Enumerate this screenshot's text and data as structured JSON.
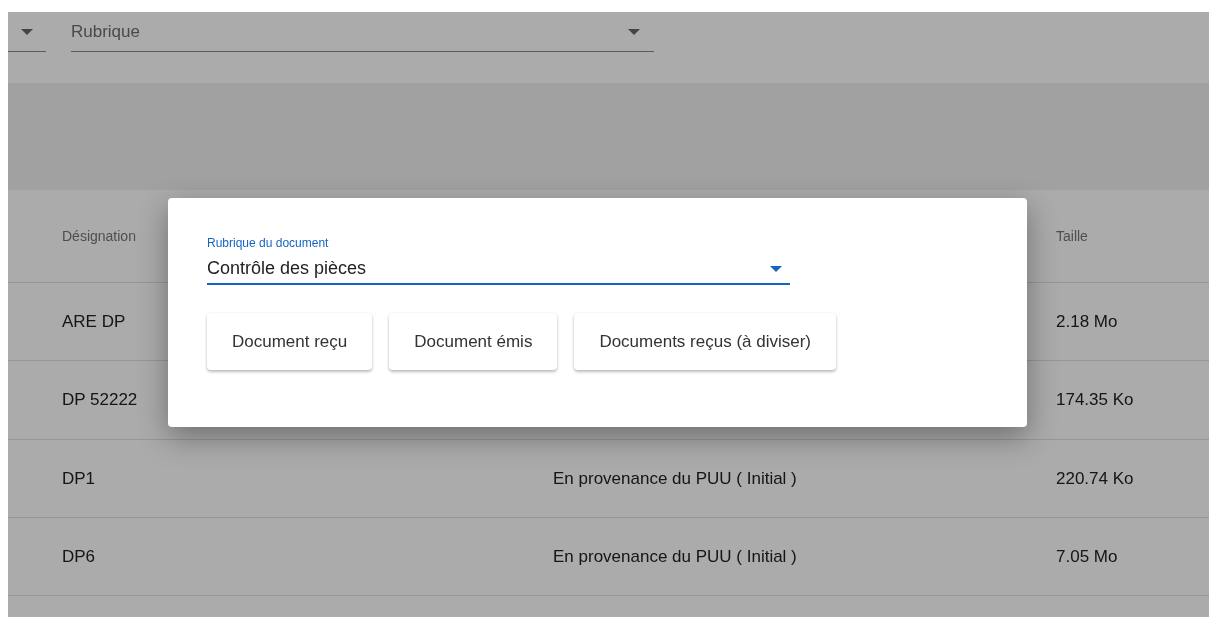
{
  "filters": [
    {
      "kind": "select"
    },
    {
      "kind": "select",
      "placeholder": "Rubrique"
    }
  ],
  "table": {
    "columns": {
      "designation": "Désignation",
      "size": "Taille"
    },
    "rows": [
      {
        "designation": "ARE DP",
        "size": "2.18 Mo"
      },
      {
        "designation": "DP 52222",
        "size": "174.35 Ko"
      },
      {
        "designation": "DP1",
        "origin": "En provenance du PUU ( Initial )",
        "size": "220.74 Ko"
      },
      {
        "designation": "DP6",
        "origin": "En provenance du PUU ( Initial )",
        "size": "7.05 Mo"
      }
    ]
  },
  "dialog": {
    "field": {
      "label": "Rubrique du document",
      "value": "Contrôle des pièces",
      "focused": true
    },
    "buttons": [
      "Document reçu",
      "Document émis",
      "Documents reçus (à diviser)"
    ]
  }
}
